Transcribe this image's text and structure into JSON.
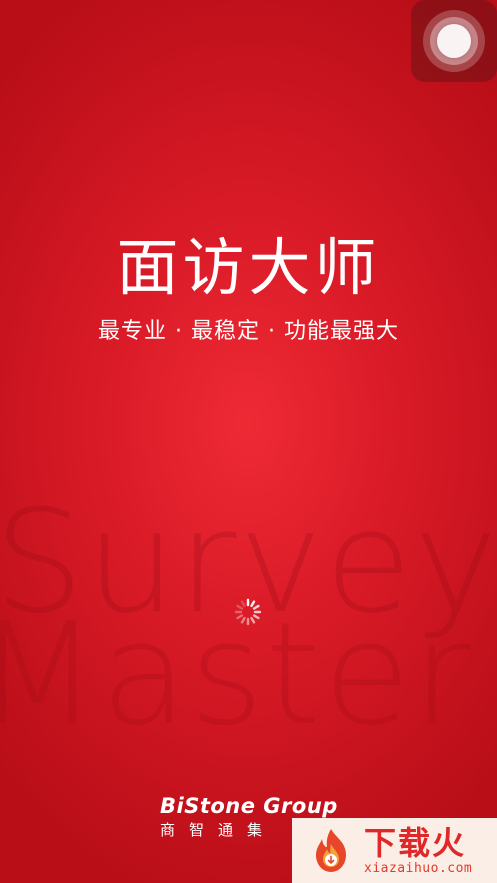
{
  "app": {
    "title": "面访大师",
    "tagline": "最专业 · 最稳定 · 功能最强大"
  },
  "watermark": {
    "line1": "Survey",
    "line2": "Master"
  },
  "footer": {
    "company_name": "BiStone Group",
    "company_cn": "商智通集"
  },
  "site_badge": {
    "name": "下载火",
    "url": "xiazaihuo.com"
  },
  "icons": {
    "assistive_touch": "assistive-touch-icon",
    "loading": "loading-spinner-icon",
    "site_logo": "fire-logo-icon"
  },
  "colors": {
    "background": "#d81a26",
    "text": "#ffffff",
    "badge_accent": "#e02828"
  }
}
